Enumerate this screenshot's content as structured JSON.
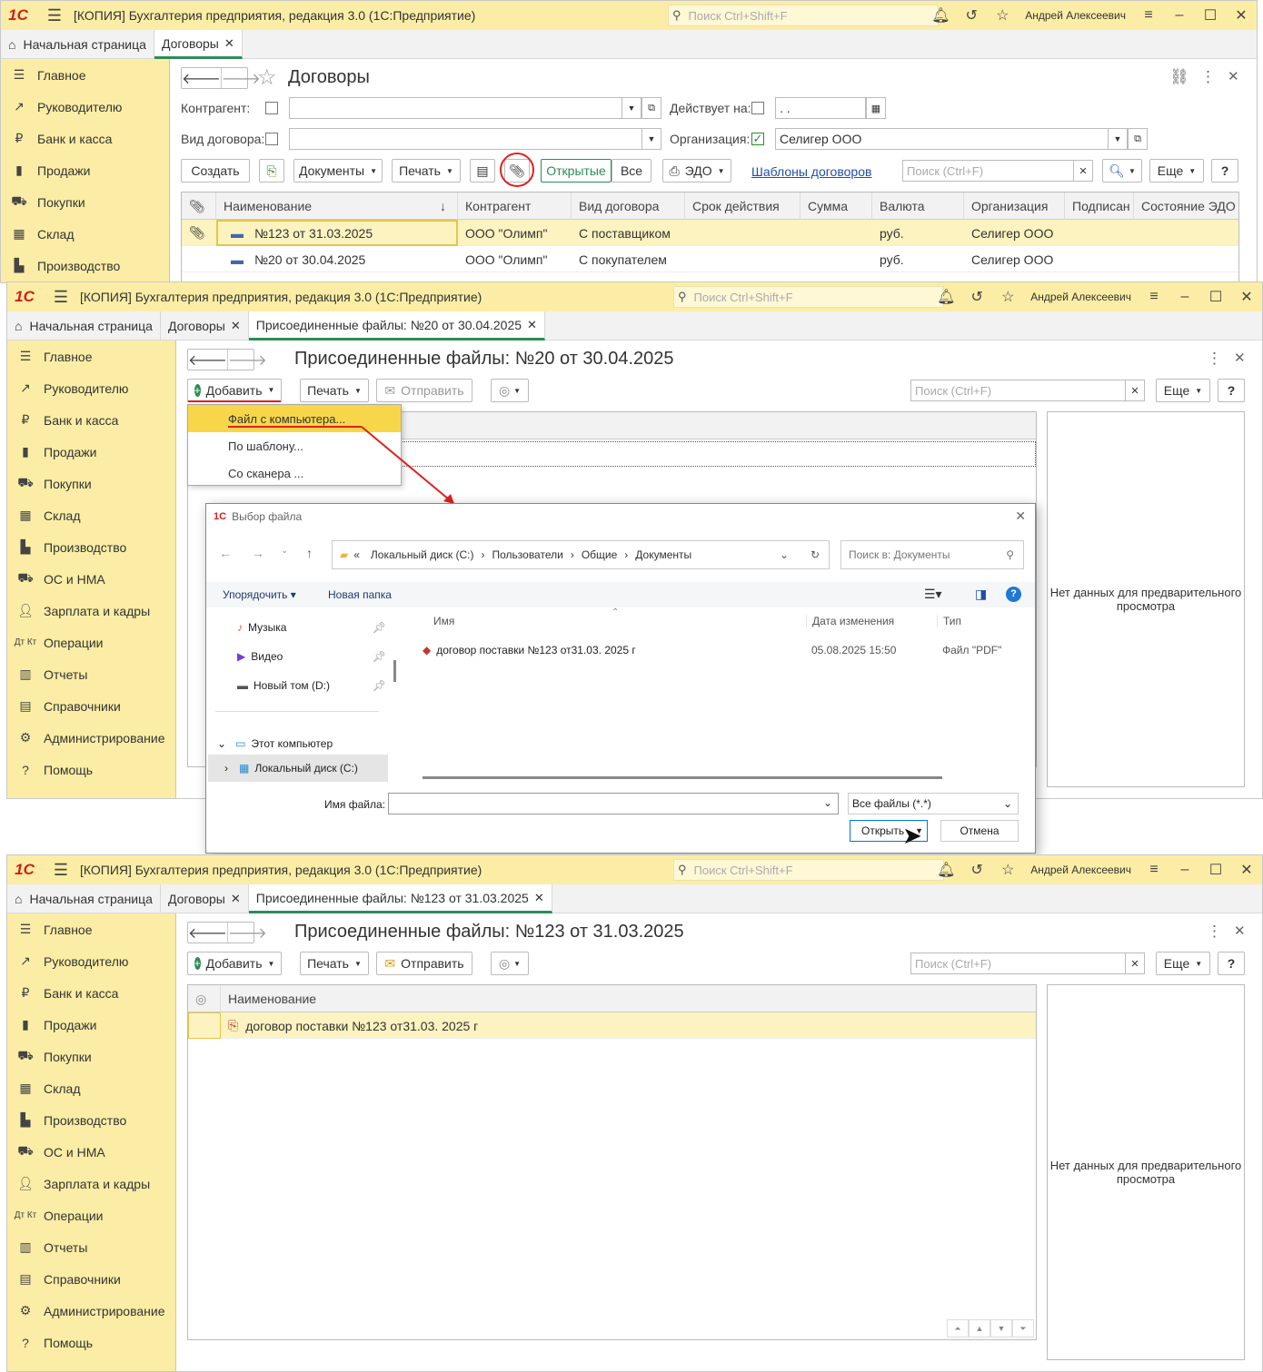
{
  "app": {
    "logo": "1С",
    "title": "[КОПИЯ] Бухгалтерия предприятия, редакция 3.0  (1С:Предприятие)",
    "search_placeholder": "Поиск Ctrl+Shift+F",
    "user": "Андрей Алексеевич"
  },
  "sidebar": {
    "items": [
      {
        "icon": "menu-icon",
        "label": "Главное"
      },
      {
        "icon": "trend-icon",
        "label": "Руководителю"
      },
      {
        "icon": "ruble-icon",
        "label": "Банк и касса"
      },
      {
        "icon": "bag-icon",
        "label": "Продажи"
      },
      {
        "icon": "cart-icon",
        "label": "Покупки"
      },
      {
        "icon": "warehouse-icon",
        "label": "Склад"
      },
      {
        "icon": "factory-icon",
        "label": "Производство"
      },
      {
        "icon": "truck-icon",
        "label": "ОС и НМА"
      },
      {
        "icon": "person-icon",
        "label": "Зарплата и кадры"
      },
      {
        "icon": "debit-credit-icon",
        "label": "Операции"
      },
      {
        "icon": "bar-chart-icon",
        "label": "Отчеты"
      },
      {
        "icon": "book-icon",
        "label": "Справочники"
      },
      {
        "icon": "gear-icon",
        "label": "Администрирование"
      },
      {
        "icon": "question-icon",
        "label": "Помощь"
      }
    ]
  },
  "win1": {
    "tabs": [
      {
        "label": "Начальная страница"
      },
      {
        "label": "Договоры"
      }
    ],
    "heading": "Договоры",
    "filters": {
      "kontragent_label": "Контрагент:",
      "vid_label": "Вид договора:",
      "deystvuet_label": "Действует на:",
      "date_value": " .  .",
      "org_label": "Организация:",
      "org_value": "Селигер ООО"
    },
    "toolbar": {
      "create": "Создать",
      "documents": "Документы",
      "print": "Печать",
      "open": "Открытые",
      "all": "Все",
      "edo": "ЭДО",
      "templates": "Шаблоны договоров",
      "search_placeholder": "Поиск (Ctrl+F)",
      "more": "Еще",
      "help": "?"
    },
    "columns": [
      "Наименование",
      "Контрагент",
      "Вид договора",
      "Срок действия",
      "Сумма",
      "Валюта",
      "Организация",
      "Подписан",
      "Состояние ЭДО"
    ],
    "rows": [
      {
        "name": "№123 от 31.03.2025",
        "kontragent": "ООО \"Олимп\"",
        "vid": "С поставщиком",
        "valuta": "руб.",
        "org": "Селигер ООО"
      },
      {
        "name": "№20 от 30.04.2025",
        "kontragent": "ООО \"Олимп\"",
        "vid": "С покупателем",
        "valuta": "руб.",
        "org": "Селигер ООО"
      }
    ]
  },
  "win2": {
    "tabs": [
      {
        "label": "Начальная страница"
      },
      {
        "label": "Договоры"
      },
      {
        "label": "Присоединенные файлы: №20 от 30.04.2025"
      }
    ],
    "heading": "Присоединенные файлы: №20 от 30.04.2025",
    "toolbar": {
      "add": "Добавить",
      "print": "Печать",
      "send": "Отправить",
      "search_placeholder": "Поиск (Ctrl+F)",
      "more": "Еще",
      "help": "?"
    },
    "add_menu": [
      "Файл с компьютера...",
      "По шаблону...",
      "Со сканера ..."
    ],
    "preview": "Нет данных для предварительного просмотра"
  },
  "dialog": {
    "title": "Выбор файла",
    "path": [
      "«",
      "Локальный диск (C:)",
      "Пользователи",
      "Общие",
      "Документы"
    ],
    "search_placeholder": "Поиск в: Документы",
    "organize": "Упорядочить",
    "new_folder": "Новая папка",
    "nav": [
      {
        "icon": "music-icon",
        "label": "Музыка"
      },
      {
        "icon": "video-icon",
        "label": "Видео"
      },
      {
        "icon": "drive-icon",
        "label": "Новый том (D:)"
      },
      {
        "icon": "computer-icon",
        "label": "Этот компьютер"
      },
      {
        "icon": "windows-drive-icon",
        "label": "Локальный диск (C:)"
      }
    ],
    "columns": [
      "Имя",
      "Дата изменения",
      "Тип"
    ],
    "files": [
      {
        "name": "договор поставки №123 от31.03. 2025 г",
        "date": "05.08.2025 15:50",
        "type": "Файл \"PDF\""
      }
    ],
    "filename_label": "Имя файла:",
    "filter": "Все файлы (*.*)",
    "open": "Открыть",
    "cancel": "Отмена"
  },
  "win3": {
    "tabs": [
      {
        "label": "Начальная страница"
      },
      {
        "label": "Договоры"
      },
      {
        "label": "Присоединенные файлы: №123 от 31.03.2025"
      }
    ],
    "heading": "Присоединенные файлы: №123 от 31.03.2025",
    "toolbar": {
      "add": "Добавить",
      "print": "Печать",
      "send": "Отправить",
      "search_placeholder": "Поиск (Ctrl+F)",
      "more": "Еще",
      "help": "?"
    },
    "column": "Наименование",
    "files": [
      {
        "name": "договор поставки №123 от31.03. 2025 г"
      }
    ],
    "preview": "Нет данных для предварительного просмотра"
  },
  "colors": {
    "accent_yellow": "#fbeda5",
    "selection": "#fdf3c0",
    "green": "#2e8b57",
    "red_annotation": "#e0201c"
  }
}
